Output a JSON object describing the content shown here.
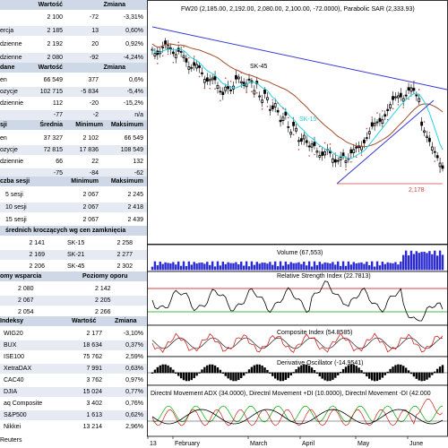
{
  "tables": {
    "t1": {
      "header": [
        "Wartość",
        "Zmiana"
      ],
      "rows": [
        [
          "",
          "2 100",
          "-72",
          "-3,31%"
        ],
        [
          "ercja",
          "2 185",
          "13",
          "0,60%"
        ],
        [
          "dzienne",
          "2 192",
          "20",
          "0,92%"
        ],
        [
          "dzienne",
          "2 080",
          "-92",
          "-4,24%"
        ]
      ]
    },
    "t2": {
      "header": [
        "dane",
        "Wartość",
        "Zmiana"
      ],
      "rows": [
        [
          "en",
          "66 549",
          "377",
          "0,6%"
        ],
        [
          "ozycje",
          "102 715",
          "-5 834",
          "-5,4%"
        ],
        [
          "dziennie",
          "112",
          "-20",
          "-15,2%"
        ],
        [
          "",
          "-77",
          "-2",
          "n/a"
        ]
      ]
    },
    "t3": {
      "header": [
        "sji",
        "Średnia",
        "Minimum",
        "Maksimum"
      ],
      "rows": [
        [
          "en",
          "37 327",
          "2 102",
          "66 549"
        ],
        [
          "ozycje",
          "72 815",
          "17 836",
          "108 549"
        ],
        [
          "dziennie",
          "66",
          "22",
          "132"
        ],
        [
          "",
          "-75",
          "-84",
          "-62"
        ]
      ]
    },
    "t4": {
      "header": [
        "czba sesji",
        "Minimum",
        "Maksimum"
      ],
      "rows": [
        [
          "5 sesji",
          "2 067",
          "2 245"
        ],
        [
          "10 sesji",
          "2 067",
          "2 418"
        ],
        [
          "15 sesji",
          "2 067",
          "2 439"
        ]
      ]
    },
    "t5": {
      "header": "średnich kroczących wg cen zamknięcia",
      "rows": [
        [
          "2 141",
          "SK-15",
          "2 258"
        ],
        [
          "2 169",
          "SK-21",
          "2 277"
        ],
        [
          "2 206",
          "SK-45",
          "2 302"
        ]
      ]
    },
    "t6": {
      "header": [
        "omy wsparcia",
        "Poziomy oporu"
      ],
      "rows": [
        [
          "2 080",
          "2 142"
        ],
        [
          "2 067",
          "2 205"
        ],
        [
          "2 054",
          "2 266"
        ]
      ]
    },
    "t7": {
      "header": [
        "Indeksy",
        "Wartość",
        "Zmiana"
      ],
      "rows": [
        [
          "WIG20",
          "2 177",
          "-3,10%"
        ],
        [
          "BUX",
          "18 634",
          "0,37%"
        ],
        [
          "ISE100",
          "75 762",
          "2,59%"
        ],
        [
          "XetraDAX",
          "7 991",
          "0,63%"
        ],
        [
          "CAC40",
          "3 762",
          "0,97%"
        ],
        [
          "DJIA",
          "15 024",
          "0,77%"
        ],
        [
          "aq Composite",
          "3 402",
          "0,76%"
        ],
        [
          "S&P500",
          "1 613",
          "0,62%"
        ],
        [
          "Nikkei",
          "13 214",
          "2,96%"
        ]
      ]
    },
    "source": "Reuters"
  },
  "chart": {
    "main_title": "FW20 (2,185.00, 2,192.00, 2,080.00, 2,100.00, -72.0000), Parabolic SAR (2,333.93)",
    "sk45_label": "SK-45",
    "sk15_label": "SK-15",
    "level_label": "2,178",
    "volume_title": "Volume (67,553)",
    "rsi_title": "Relative Strength Index (22.7813)",
    "composite_title": "Composite Index (54.8585)",
    "derivative_title": "Derivative Oscillator (-14.9541)",
    "dmi_title": "Directnl Movement ADX (34.0000), Directnl Movement +DI (10.0000), Directnl Movement -DI (42.000",
    "x_labels": [
      "13",
      "February",
      "March",
      "April",
      "May",
      "June"
    ],
    "colors": {
      "candle_up": "#ffffff",
      "candle_down": "#000000",
      "trend_blue": "#3b3bd6",
      "sk45": "#a34d2a",
      "sk15": "#2ad0e0",
      "sar": "#d04040",
      "rsi_line": "#000000",
      "rsi_ob": "#cc0000",
      "rsi_os": "#00aa00",
      "volume": "#2a2ad0",
      "composite": "#d02020",
      "dmi_adx": "#000000",
      "dmi_plus": "#00aa00",
      "dmi_minus": "#d02020"
    }
  }
}
